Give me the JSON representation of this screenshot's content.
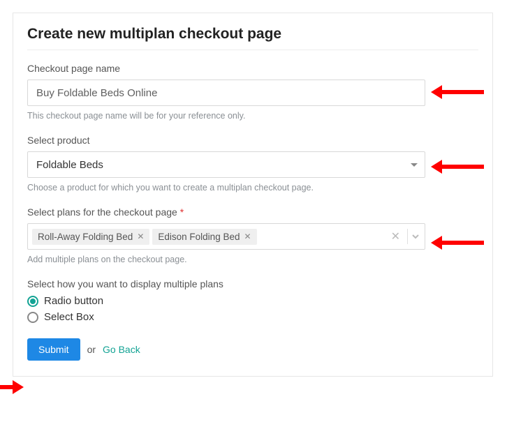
{
  "title": "Create new multiplan checkout page",
  "checkout_name": {
    "label": "Checkout page name",
    "value": "Buy Foldable Beds Online",
    "help": "This checkout page name will be for your reference only."
  },
  "product": {
    "label": "Select product",
    "value": "Foldable Beds",
    "help": "Choose a product for which you want to create a multiplan checkout page."
  },
  "plans": {
    "label": "Select plans for the checkout page",
    "required_marker": "*",
    "chips": [
      {
        "label": "Roll-Away Folding Bed"
      },
      {
        "label": "Edison Folding Bed"
      }
    ],
    "help": "Add multiple plans on the checkout page."
  },
  "display": {
    "label": "Select how you want to display multiple plans",
    "options": [
      {
        "label": "Radio button",
        "selected": true
      },
      {
        "label": "Select Box",
        "selected": false
      }
    ]
  },
  "actions": {
    "submit": "Submit",
    "or": "or",
    "go_back": "Go Back"
  }
}
